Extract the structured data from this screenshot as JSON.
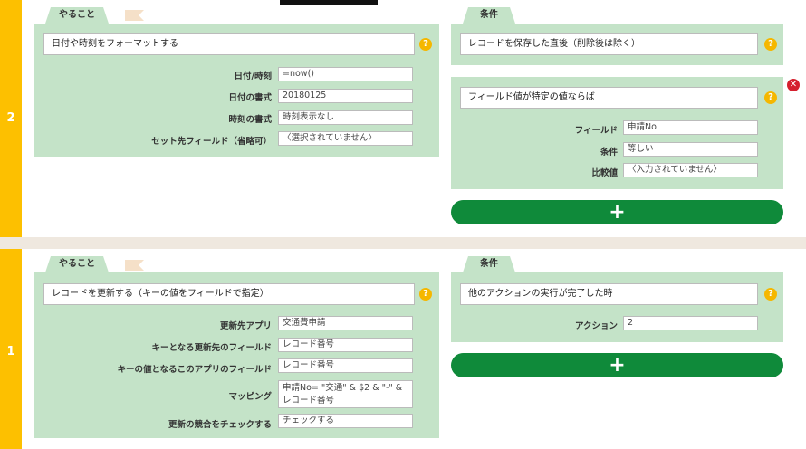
{
  "steps": [
    {
      "number": "2",
      "action": {
        "tab": "やること",
        "title": "日付や時刻をフォーマットする",
        "fields": [
          {
            "label": "日付/時刻",
            "value": "=now()"
          },
          {
            "label": "日付の書式",
            "value": "20180125"
          },
          {
            "label": "時刻の書式",
            "value": "時刻表示なし"
          },
          {
            "label": "セット先フィールド（省略可）",
            "value": "〈選択されていません〉"
          }
        ]
      },
      "conditions_tab": "条件",
      "conditions": [
        {
          "title": "レコードを保存した直後（削除後は除く）"
        },
        {
          "title": "フィールド値が特定の値ならば",
          "fields": [
            {
              "label": "フィールド",
              "value": "申請No"
            },
            {
              "label": "条件",
              "value": "等しい"
            },
            {
              "label": "比較値",
              "value": "〈入力されていません〉"
            }
          ]
        }
      ],
      "add_label": "+"
    },
    {
      "number": "1",
      "action": {
        "tab": "やること",
        "title": "レコードを更新する（キーの値をフィールドで指定）",
        "fields": [
          {
            "label": "更新先アプリ",
            "value": "交通費申請"
          },
          {
            "label": "キーとなる更新先のフィールド",
            "value": "レコード番号"
          },
          {
            "label": "キーの値となるこのアプリのフィールド",
            "value": "レコード番号"
          },
          {
            "label": "マッピング",
            "value": "申請No= \"交通\" & $2 & \"-\" & レコード番号"
          },
          {
            "label": "更新の競合をチェックする",
            "value": "チェックする"
          }
        ]
      },
      "conditions_tab": "条件",
      "conditions": [
        {
          "title": "他のアクションの実行が完了した時",
          "fields": [
            {
              "label": "アクション",
              "value": "2"
            }
          ]
        }
      ],
      "add_label": "+"
    }
  ],
  "icons": {
    "help": "help-icon",
    "delete": "delete-icon",
    "add": "plus-icon"
  },
  "colors": {
    "step_bar": "#fdc000",
    "panel": "#c4e3c8",
    "add_button": "#0f8a3a",
    "delete": "#d5202e",
    "help": "#f5b700"
  }
}
